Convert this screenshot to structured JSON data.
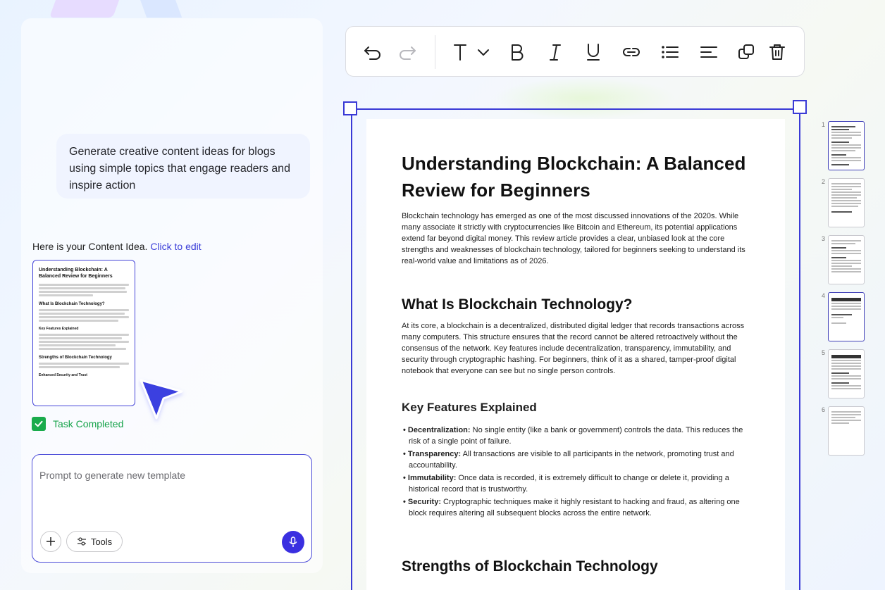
{
  "chat": {
    "user_message": "Generate creative content ideas for blogs using simple topics that engage readers and inspire action",
    "response_prefix": "Here is your Content Idea.",
    "response_link": "Click to edit",
    "preview": {
      "title": "Understanding Blockchain: A Balanced Review for Beginners",
      "h_what": "What Is Blockchain Technology?",
      "h_key": "Key Features Explained",
      "h_strengths": "Strengths of Blockchain Technology",
      "h_security": "Enhanced Security and Trust"
    },
    "task_status": "Task Completed"
  },
  "prompt": {
    "placeholder": "Prompt to generate new template",
    "tools_label": "Tools"
  },
  "toolbar": {
    "items": [
      "undo-icon",
      "redo-icon",
      "text-style-icon",
      "bold-icon",
      "italic-icon",
      "underline-icon",
      "link-icon",
      "list-icon",
      "align-icon",
      "duplicate-icon",
      "delete-icon"
    ]
  },
  "document": {
    "title": "Understanding Blockchain: A Balanced Review for Beginners",
    "intro": "Blockchain technology has emerged as one of the most discussed innovations of the 2020s. While many associate it strictly with cryptocurrencies like Bitcoin and Ethereum, its potential applications extend far beyond digital money. This review article provides a clear, unbiased look at the core strengths and weaknesses of blockchain technology, tailored for beginners seeking to understand its real-world value and limitations as of 2026.",
    "section1_title": "What Is Blockchain Technology?",
    "section1_body": "At its core, a blockchain is a decentralized, distributed digital ledger that records transactions across many computers. This structure ensures that the record cannot be altered retroactively without the consensus of the network. Key features include decentralization, transparency, immutability, and security through cryptographic hashing. For beginners, think of it as a shared, tamper-proof digital notebook that everyone can see but no single person controls.",
    "subsection_title": "Key Features Explained",
    "features": [
      {
        "term": "Decentralization:",
        "text": " No single entity (like a bank or government) controls the data. This reduces the risk of a single point of failure."
      },
      {
        "term": "Transparency:",
        "text": " All transactions are visible to all participants in the network, promoting trust and accountability."
      },
      {
        "term": "Immutability:",
        "text": " Once data is recorded, it is extremely difficult to change or delete it, providing a historical record that is trustworthy."
      },
      {
        "term": "Security:",
        "text": " Cryptographic techniques make it highly resistant to hacking and fraud, as altering one block requires altering all subsequent blocks across the entire network."
      }
    ],
    "section2_title": "Strengths of Blockchain Technology"
  },
  "pages": {
    "numbers": [
      "1",
      "2",
      "3",
      "4",
      "5",
      "6"
    ],
    "active_page": "1"
  },
  "colors": {
    "accent": "#3a3ad6",
    "mic": "#3a2fe0",
    "success": "#16a34a",
    "link": "#3b3ed8"
  }
}
